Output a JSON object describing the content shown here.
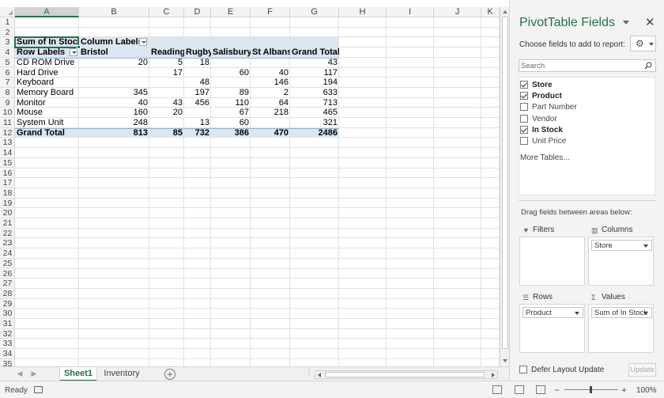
{
  "columns": [
    "A",
    "B",
    "C",
    "D",
    "E",
    "F",
    "G",
    "H",
    "I",
    "J",
    "K"
  ],
  "rows": [
    "1",
    "2",
    "3",
    "4",
    "5",
    "6",
    "7",
    "8",
    "9",
    "10",
    "11",
    "12",
    "13",
    "14",
    "15",
    "16",
    "17",
    "18",
    "19",
    "20",
    "21",
    "22",
    "23",
    "24",
    "25",
    "26",
    "27",
    "28",
    "29",
    "30",
    "31",
    "32",
    "33",
    "34",
    "35"
  ],
  "pivot": {
    "value_label": "Sum of In Stock",
    "column_labels": "Column Labels",
    "row_labels": "Row Labels",
    "col_headers": [
      "Bristol",
      "Reading",
      "Rugby",
      "Salisbury",
      "St Albans",
      "Grand Total"
    ],
    "body": [
      [
        "CD ROM Drive",
        "20",
        "5",
        "18",
        "",
        "",
        "43"
      ],
      [
        "Hard Drive",
        "",
        "17",
        "",
        "60",
        "40",
        "117"
      ],
      [
        "Keyboard",
        "",
        "",
        "48",
        "",
        "146",
        "194"
      ],
      [
        "Memory Board",
        "345",
        "",
        "197",
        "89",
        "2",
        "633"
      ],
      [
        "Monitor",
        "40",
        "43",
        "456",
        "110",
        "64",
        "713"
      ],
      [
        "Mouse",
        "160",
        "20",
        "",
        "67",
        "218",
        "465"
      ],
      [
        "System Unit",
        "248",
        "",
        "13",
        "60",
        "",
        "321"
      ]
    ],
    "grand_total": [
      "Grand Total",
      "813",
      "85",
      "732",
      "386",
      "470",
      "2486"
    ]
  },
  "tabs": {
    "sheets": [
      "Sheet1",
      "Inventory"
    ],
    "active": "Sheet1"
  },
  "status": {
    "ready": "Ready",
    "zoom": "100%",
    "minus": "−",
    "plus": "+"
  },
  "pane": {
    "title": "PivotTable Fields",
    "close": "✕",
    "choose": "Choose fields to add to report:",
    "search_placeholder": "Search",
    "fields": [
      {
        "label": "Store",
        "checked": true
      },
      {
        "label": "Product",
        "checked": true
      },
      {
        "label": "Part Number",
        "checked": false
      },
      {
        "label": "Vendor",
        "checked": false
      },
      {
        "label": "In Stock",
        "checked": true
      },
      {
        "label": "Unit Price",
        "checked": false
      }
    ],
    "more_tables": "More Tables...",
    "drag_text": "Drag fields between areas below:",
    "areas": {
      "filters": {
        "title": "Filters",
        "items": []
      },
      "columns": {
        "title": "Columns",
        "items": [
          "Store"
        ]
      },
      "rows": {
        "title": "Rows",
        "items": [
          "Product"
        ]
      },
      "values": {
        "title": "Values",
        "items": [
          "Sum of In Stock"
        ]
      }
    },
    "defer": "Defer Layout Update",
    "update": "Update"
  },
  "colors": {
    "accent": "#217346",
    "pivot_band": "#dce6f1",
    "pivot_border": "#95b3d7"
  }
}
